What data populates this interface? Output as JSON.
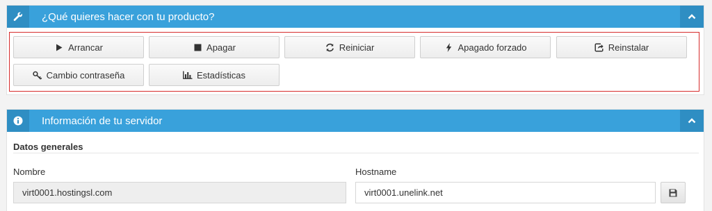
{
  "product_panel": {
    "title": "¿Qué quieres hacer con tu producto?",
    "icon": "wrench-icon",
    "actions": [
      {
        "label": "Arrancar",
        "icon": "play-icon"
      },
      {
        "label": "Apagar",
        "icon": "stop-icon"
      },
      {
        "label": "Reiniciar",
        "icon": "refresh-icon"
      },
      {
        "label": "Apagado forzado",
        "icon": "bolt-icon"
      },
      {
        "label": "Reinstalar",
        "icon": "share-icon"
      },
      {
        "label": "Cambio contraseña",
        "icon": "key-icon"
      },
      {
        "label": "Estadísticas",
        "icon": "bar-chart-icon"
      }
    ]
  },
  "server_panel": {
    "title": "Información de tu servidor",
    "icon": "info-icon",
    "section_title": "Datos generales",
    "fields": {
      "name": {
        "label": "Nombre",
        "value": "virt0001.hostingsl.com"
      },
      "hostname": {
        "label": "Hostname",
        "value": "virt0001.unelink.net"
      }
    }
  },
  "colors": {
    "header_bg": "#39a1db",
    "header_icon_bg": "#2f8ec3",
    "highlight_border": "#d62b2b"
  }
}
